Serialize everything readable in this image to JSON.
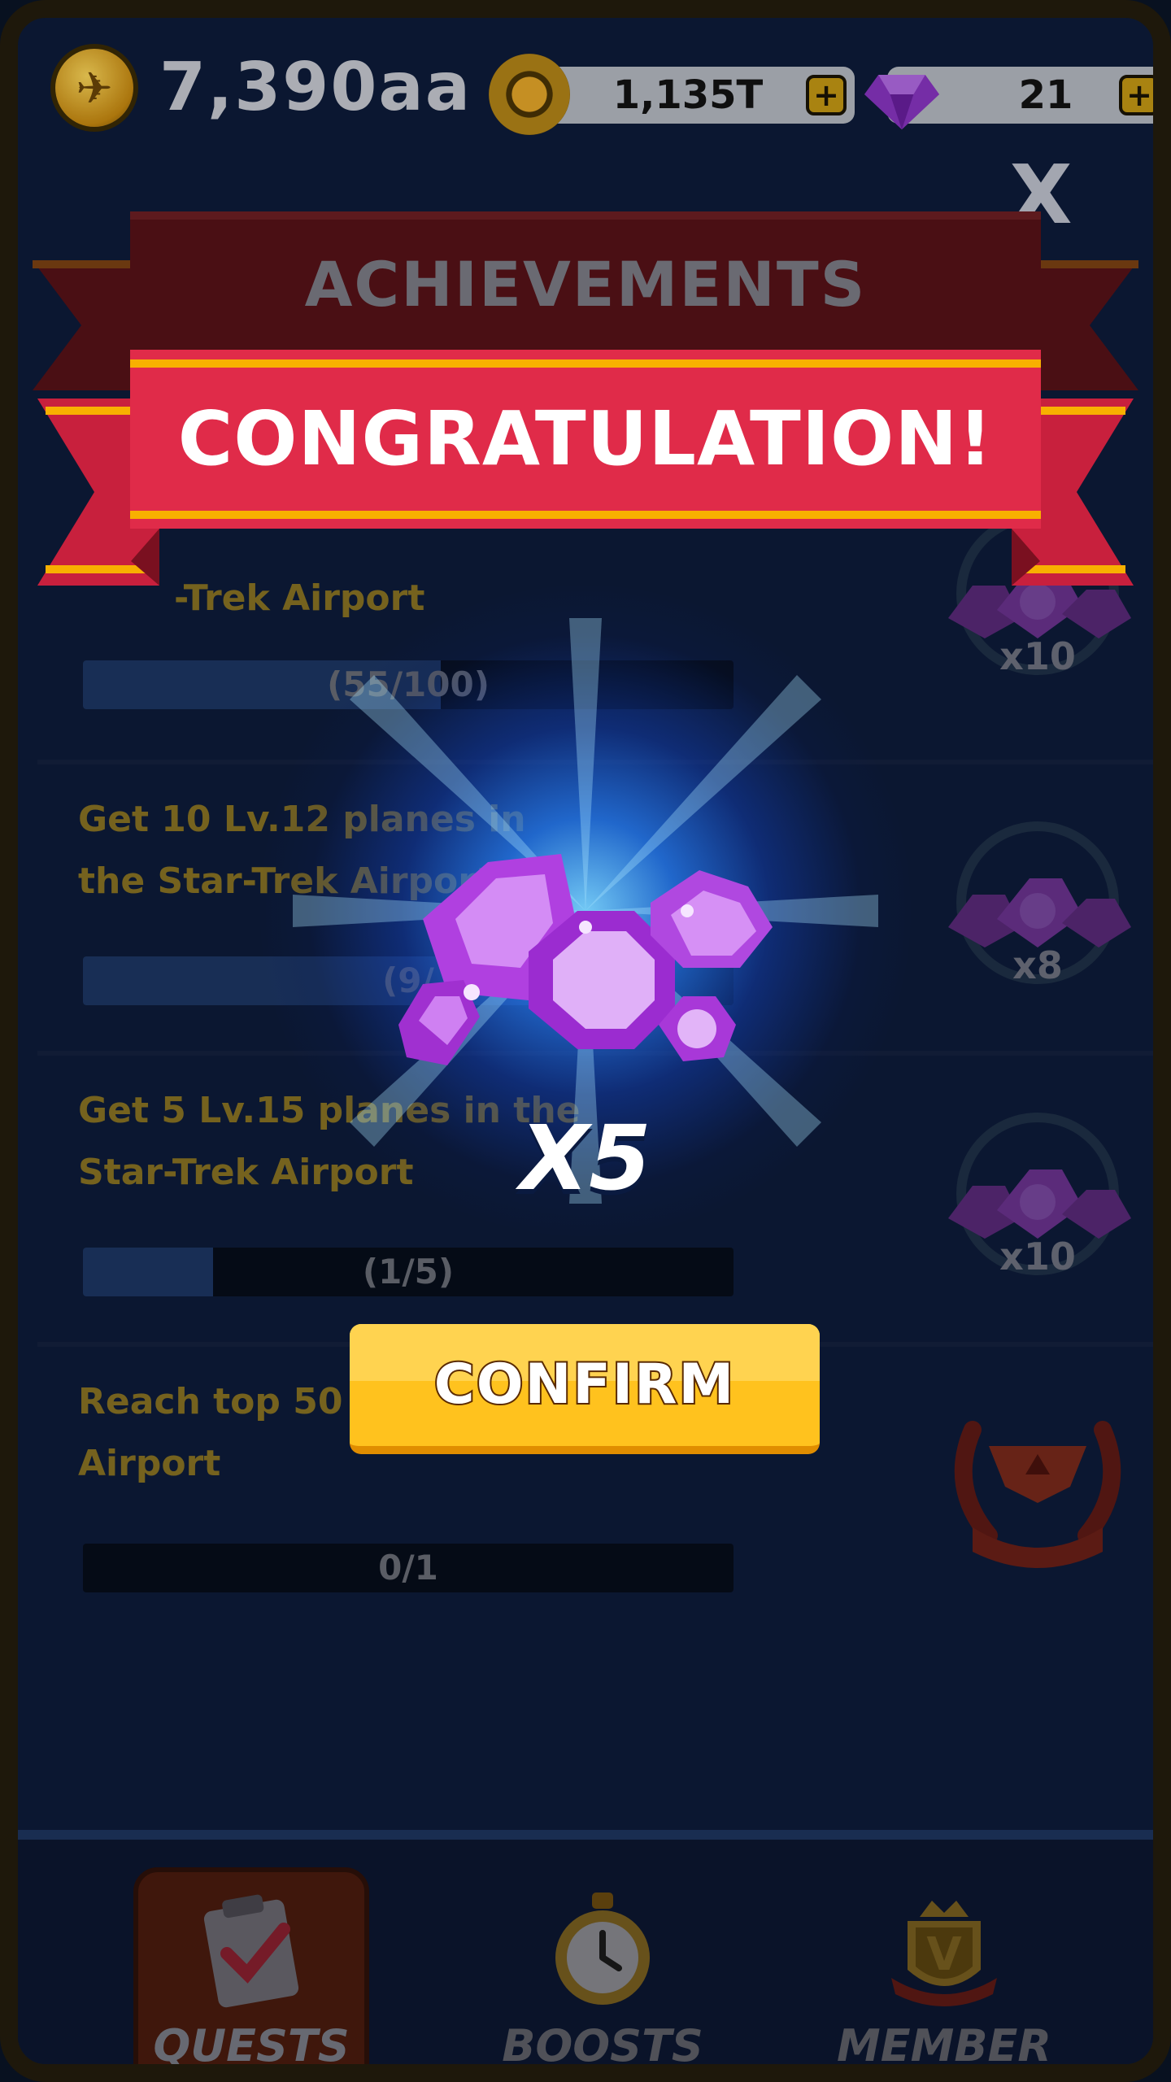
{
  "currency": {
    "coins": "7,390aa",
    "tickets": "1,135T",
    "gems": "21",
    "plus_symbol": "+"
  },
  "modal": {
    "close_label": "X",
    "banner_back_title": "ACHIEVEMENTS",
    "banner_title": "CONGRATULATION!",
    "reward_amount": "X5",
    "confirm_label": "CONFIRM"
  },
  "quests": [
    {
      "title": "Get 100 Lv.9 planes in the Star-Trek Airport",
      "title_visible": "-Trek Airport",
      "progress_text": "(55/100)",
      "progress": 0.55,
      "reward": "x10"
    },
    {
      "title": "Get 10 Lv.12 planes in the Star-Trek Airport",
      "progress_text": "(9/",
      "progress": 0.9,
      "reward": "x8"
    },
    {
      "title": "Get 5 Lv.15 planes in the Star-Trek Airport",
      "progress_text": "(1/5)",
      "progress": 0.2,
      "reward": "x10"
    },
    {
      "title": "Reach top 50 i Airport",
      "progress_text": "0/1",
      "progress": 0.0,
      "reward": ""
    }
  ],
  "nav": {
    "items": [
      {
        "label": "QUESTS",
        "icon": "clipboard-check-icon",
        "active": true
      },
      {
        "label": "BOOSTS",
        "icon": "stopwatch-icon",
        "active": false
      },
      {
        "label": "MEMBER",
        "icon": "vip-crown-badge-icon",
        "active": false
      }
    ]
  },
  "colors": {
    "banner_red": "#e02b49",
    "banner_stripe": "#f8b000",
    "confirm_yellow": "#ffc21e",
    "gem_purple": "#b44be0",
    "glow_blue": "#3f8cff"
  }
}
